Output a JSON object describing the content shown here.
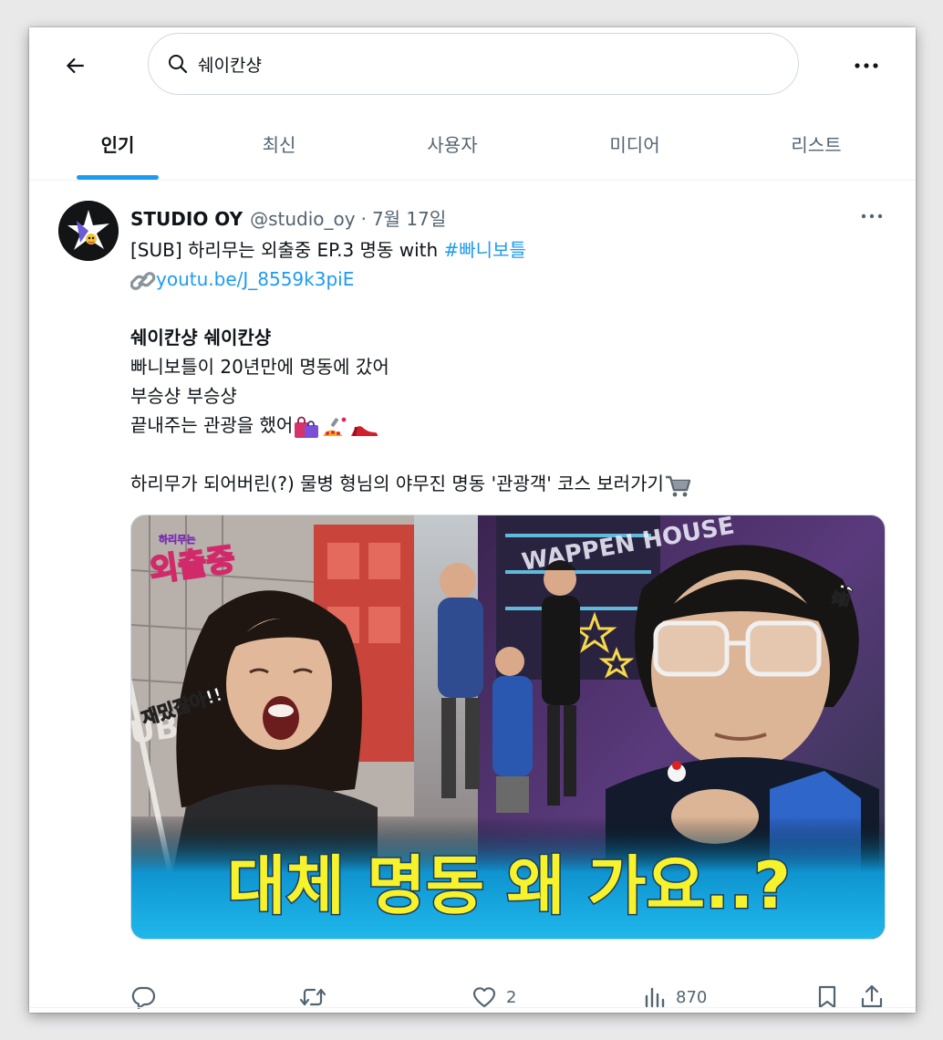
{
  "search": {
    "query": "쉐이칸샹"
  },
  "icons": {
    "back": "back-arrow-icon",
    "search": "search-icon",
    "more": "more-horizontal-icon",
    "reply": "reply-icon",
    "retweet": "retweet-icon",
    "like": "heart-icon",
    "views": "views-icon",
    "bookmark": "bookmark-icon",
    "share": "share-icon",
    "link": "link-icon"
  },
  "tabs": [
    {
      "label": "인기",
      "active": true
    },
    {
      "label": "최신",
      "active": false
    },
    {
      "label": "사용자",
      "active": false
    },
    {
      "label": "미디어",
      "active": false
    },
    {
      "label": "리스트",
      "active": false
    }
  ],
  "tweet": {
    "author": "STUDIO OY",
    "handle": "@studio_oy",
    "separator": "·",
    "date": "7월 17일",
    "line1_text": "[SUB] 하리무는 외출중 EP.3 명동 with ",
    "line1_hashtag": "#빠니보틀",
    "link_text": "youtu.be/J_8559k3piE",
    "bold_line": "쉐이칸샹 쉐이칸샹",
    "line3": "빠니보틀이 20년만에 명동에 갔어",
    "line4": "부승샹 부승샹",
    "line5": "끝내주는 관광을 했어",
    "line5_emoji": [
      "shopping-bags-icon",
      "nail-polish-icon",
      "high-heel-icon"
    ],
    "line6": "하리무가 되어버린(?) 물병 형님의 야무진 명동 '관광객' 코스 보러가기",
    "line6_emoji": "shopping-cart-icon",
    "media": {
      "logo_text": "외출중",
      "logo_small": "하리무는",
      "left_caption": "재밌잖아!!",
      "sign_text": "UBLIC",
      "sign_right": "WAPPEN HOUSE",
      "right_caption": "흠;",
      "bottom_caption": "대체 명동 왜 가요..?"
    },
    "stats": {
      "likes": "2",
      "views": "870"
    }
  }
}
